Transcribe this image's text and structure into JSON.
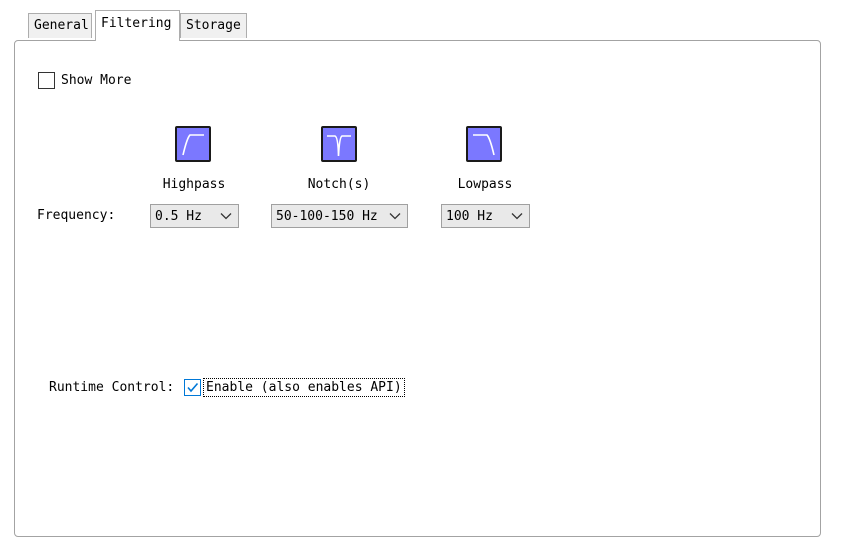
{
  "tabs": [
    {
      "label": "General"
    },
    {
      "label": "Filtering"
    },
    {
      "label": "Storage"
    }
  ],
  "show_more": {
    "label": "Show More",
    "checked": false
  },
  "filters": [
    {
      "name": "Highpass",
      "icon": "highpass-filter-icon",
      "frequency": "0.5 Hz"
    },
    {
      "name": "Notch(s)",
      "icon": "notch-filter-icon",
      "frequency": "50-100-150 Hz"
    },
    {
      "name": "Lowpass",
      "icon": "lowpass-filter-icon",
      "frequency": "100 Hz"
    }
  ],
  "frequency_label": "Frequency:",
  "runtime_control": {
    "label": "Runtime Control:",
    "checkbox_label": "Enable (also enables API)",
    "checked": true
  },
  "colors": {
    "filter_icon_fill": "#7b78ff",
    "check_accent": "#0078d7"
  }
}
